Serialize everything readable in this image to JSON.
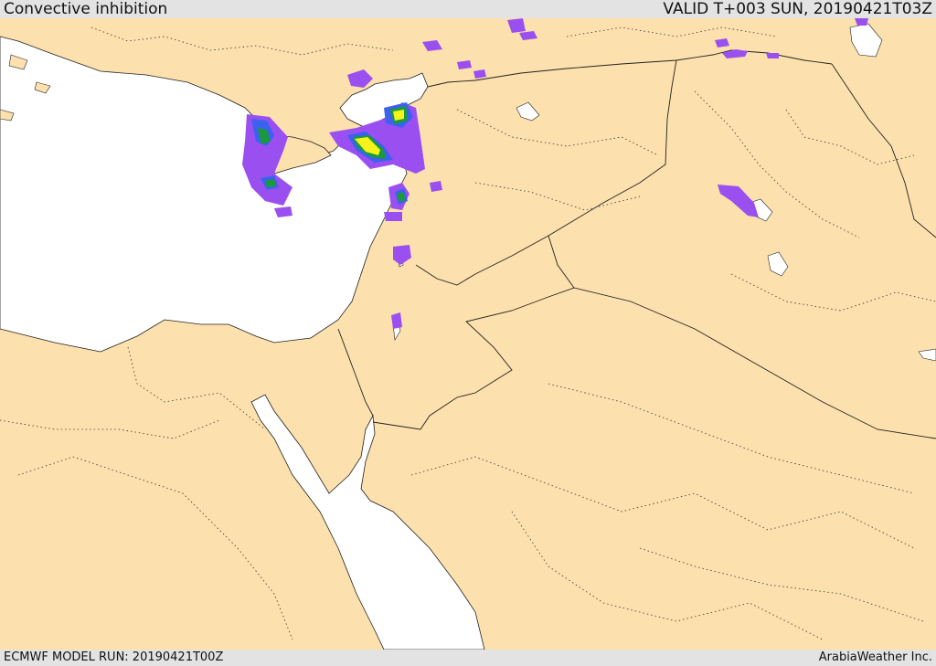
{
  "header": {
    "title": "Convective inhibition",
    "valid": "VALID T+003 SUN, 20190421T03Z"
  },
  "footer": {
    "model_run": "ECMWF MODEL RUN: 20190421T00Z",
    "credit": "ArabiaWeather Inc."
  },
  "colors": {
    "land": "#fce0ad",
    "water": "#ffffff",
    "cin_purple": "#9a4ff0",
    "cin_blue": "#3b62ee",
    "cin_green": "#1a9a3a",
    "cin_yellow": "#f6f21c"
  }
}
